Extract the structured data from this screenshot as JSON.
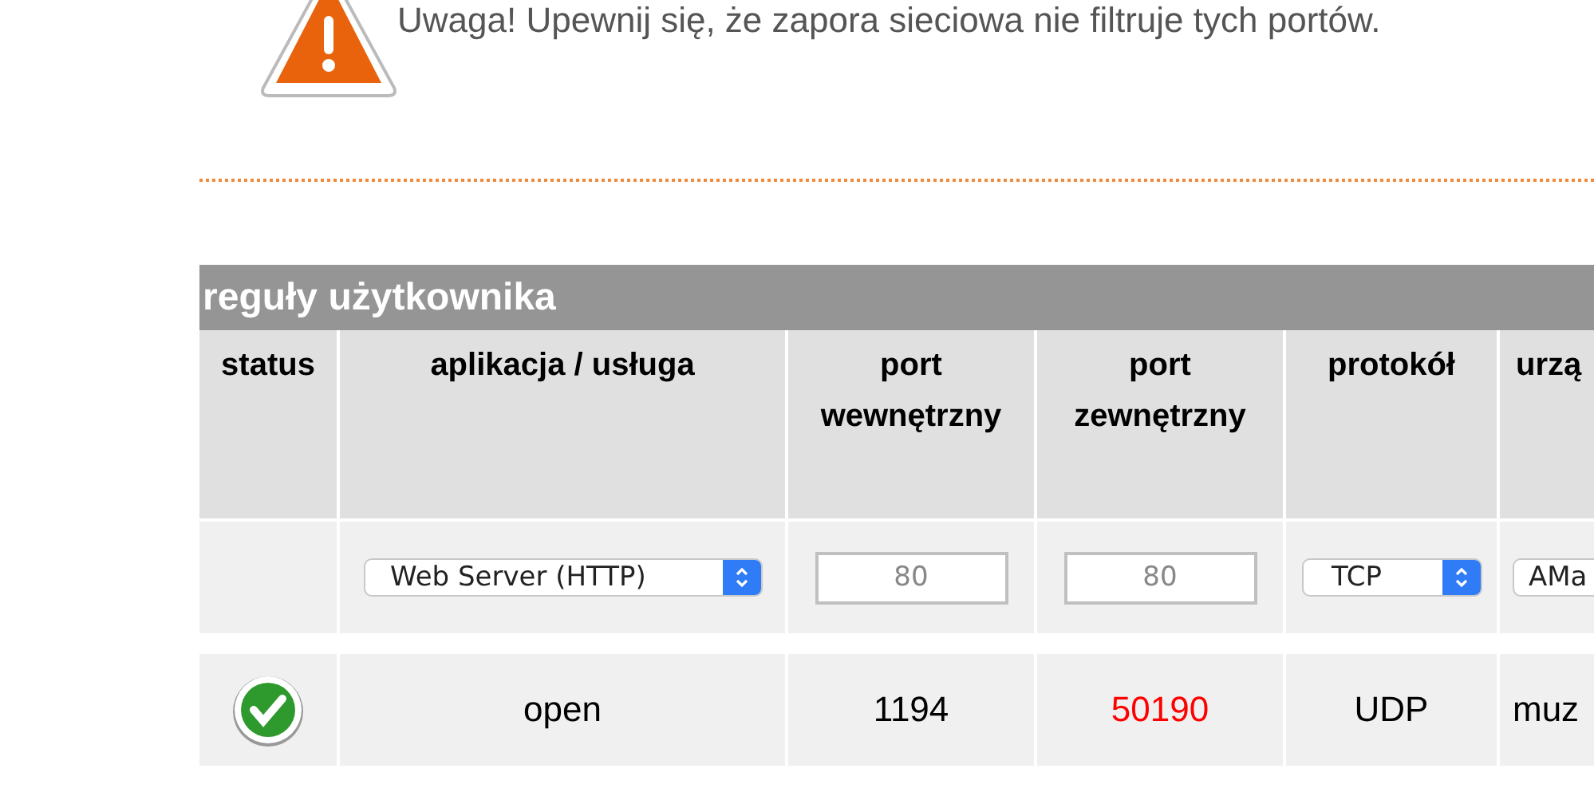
{
  "warning": {
    "text": "Uwaga! Upewnij się, że zapora sieciowa nie filtruje tych portów."
  },
  "table": {
    "title": "reguły użytkownika",
    "columns": [
      {
        "label": "status"
      },
      {
        "label": "aplikacja / usługa"
      },
      {
        "label": "port wewnętrzny"
      },
      {
        "label": "port zewnętrzny"
      },
      {
        "label": "protokół"
      },
      {
        "label": "urzą"
      }
    ],
    "input_row": {
      "service": "Web Server (HTTP)",
      "internal_port_placeholder": "80",
      "external_port_placeholder": "80",
      "protocol": "TCP",
      "device": "AMa"
    },
    "rows": [
      {
        "status_ok": true,
        "service": "open",
        "internal_port": "1194",
        "external_port": "50190",
        "external_port_alert": true,
        "protocol": "UDP",
        "device": "muz"
      }
    ]
  }
}
